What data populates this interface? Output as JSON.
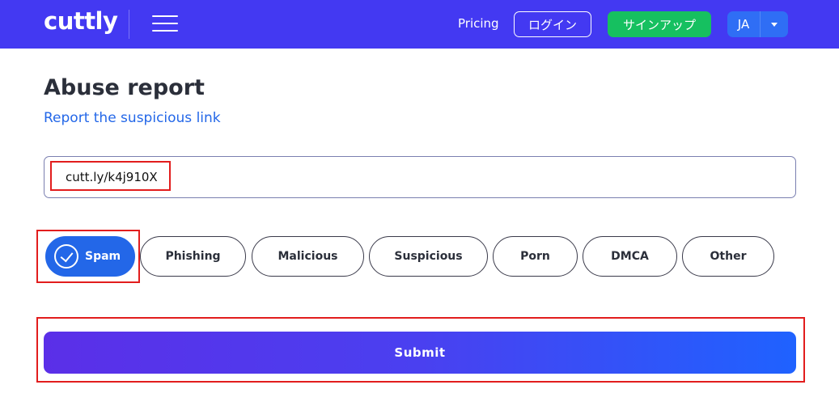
{
  "header": {
    "logo": "cuttly",
    "pricing": "Pricing",
    "login": "ログイン",
    "signup": "サインアップ",
    "language": "JA"
  },
  "page": {
    "title": "Abuse report",
    "subtitle": "Report the suspicious link"
  },
  "form": {
    "url_value": "cutt.ly/k4j910X",
    "categories": [
      "Spam",
      "Phishing",
      "Malicious",
      "Suspicious",
      "Porn",
      "DMCA",
      "Other"
    ],
    "selected_category": "Spam",
    "submit_label": "Submit"
  },
  "colors": {
    "header_bg": "#4339f2",
    "accent_blue": "#2367e8",
    "signup_green": "#16c060",
    "highlight_red": "#e21d1d"
  }
}
